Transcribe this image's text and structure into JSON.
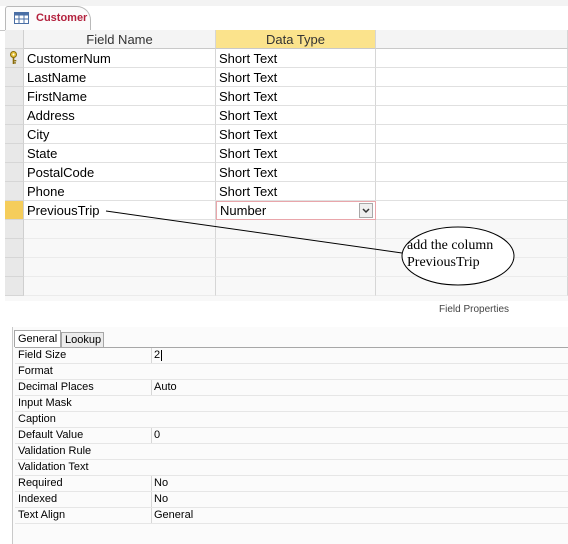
{
  "document_tab": {
    "label": "Customer",
    "icon": "table-icon"
  },
  "columns": {
    "field_name": "Field Name",
    "data_type": "Data Type"
  },
  "rows": [
    {
      "field": "CustomerNum",
      "type": "Short Text",
      "primary_key": true
    },
    {
      "field": "LastName",
      "type": "Short Text"
    },
    {
      "field": "FirstName",
      "type": "Short Text"
    },
    {
      "field": "Address",
      "type": "Short Text"
    },
    {
      "field": "City",
      "type": "Short Text"
    },
    {
      "field": "State",
      "type": "Short Text"
    },
    {
      "field": "PostalCode",
      "type": "Short Text"
    },
    {
      "field": "Phone",
      "type": "Short Text"
    },
    {
      "field": "PreviousTrip",
      "type": "Number",
      "current": true
    }
  ],
  "field_properties": {
    "label": "Field Properties",
    "tabs": [
      "General",
      "Lookup"
    ],
    "active_tab": "General",
    "properties": [
      {
        "name": "Field Size",
        "value": "2"
      },
      {
        "name": "Format",
        "value": ""
      },
      {
        "name": "Decimal Places",
        "value": "Auto"
      },
      {
        "name": "Input Mask",
        "value": ""
      },
      {
        "name": "Caption",
        "value": ""
      },
      {
        "name": "Default Value",
        "value": "0"
      },
      {
        "name": "Validation Rule",
        "value": ""
      },
      {
        "name": "Validation Text",
        "value": ""
      },
      {
        "name": "Required",
        "value": "No"
      },
      {
        "name": "Indexed",
        "value": "No"
      },
      {
        "name": "Text Align",
        "value": "General"
      }
    ]
  },
  "callout": {
    "line1": "add the column",
    "line2": "PreviousTrip"
  },
  "colors": {
    "selected_header": "#fbe38c",
    "row_selector_current": "#f5cd5b",
    "tab_label": "#b3213d"
  }
}
